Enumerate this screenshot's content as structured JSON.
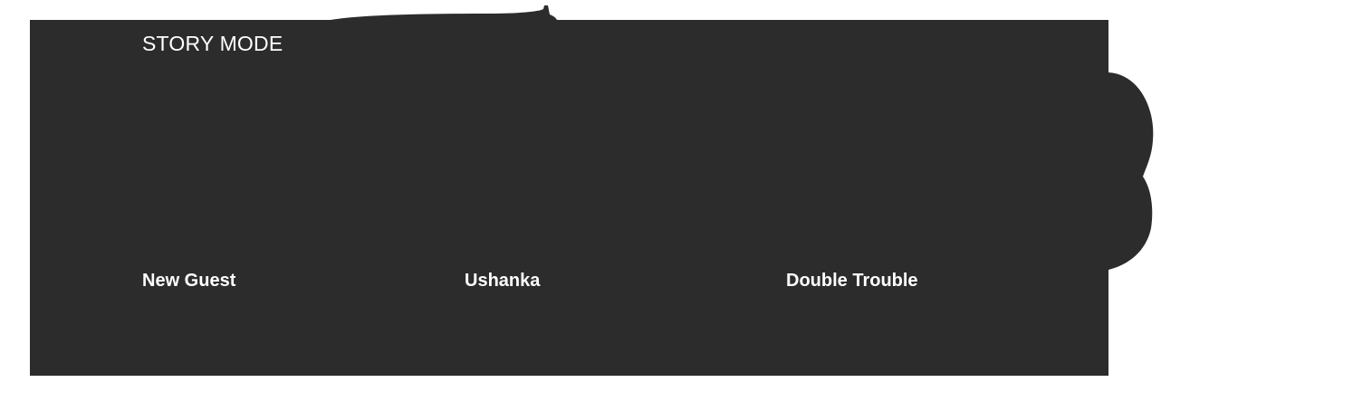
{
  "section": {
    "title": "STORY MODE"
  },
  "cards": [
    {
      "title": "New Guest"
    },
    {
      "title": "Ushanka"
    },
    {
      "title": "Double Trouble"
    }
  ],
  "colors": {
    "panel_background": "#2c2c2c",
    "text": "#ffffff",
    "page_background": "#ffffff"
  }
}
